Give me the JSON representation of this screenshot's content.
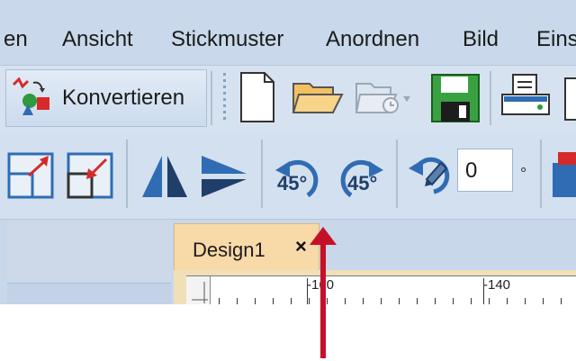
{
  "menu": {
    "items": [
      {
        "label": "en"
      },
      {
        "label": "Ansicht"
      },
      {
        "label": "Stickmuster"
      },
      {
        "label": "Anordnen"
      },
      {
        "label": "Bild"
      },
      {
        "label": "Eins"
      }
    ]
  },
  "toolbar1": {
    "konvertieren_label": "Konvertieren"
  },
  "toolbar2": {
    "rotate_left_label": "45°",
    "rotate_right_label": "45°",
    "angle_value": "0",
    "angle_unit": "°"
  },
  "document": {
    "tab_label": "Design1",
    "close_symbol": "×"
  },
  "ruler": {
    "labels": [
      "-160",
      "-140"
    ]
  },
  "colors": {
    "arrow": "#c5102a",
    "tab_active": "#f8d9a8",
    "icon_blue": "#2f6cb3"
  }
}
